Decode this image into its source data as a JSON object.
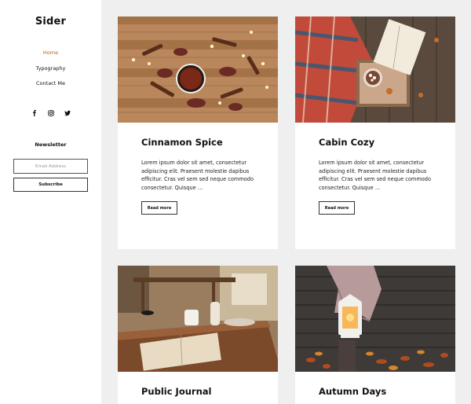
{
  "site": {
    "title": "Sider"
  },
  "nav": {
    "items": [
      "Home",
      "Typography",
      "Contact Me"
    ]
  },
  "social": {
    "icons": [
      "facebook-icon",
      "instagram-icon",
      "twitter-icon"
    ]
  },
  "newsletter": {
    "title": "Newsletter",
    "email_placeholder": "Email Address",
    "subscribe_label": "Subscribe"
  },
  "posts": [
    {
      "title": "Cinnamon Spice",
      "excerpt": "Lorem ipsum dolor sit amet, consectetur adipiscing elit. Praesent molestie dapibus efficitur. Cras vel sem sed neque commodo consectetur. Quisque …",
      "read_more": "Read more"
    },
    {
      "title": "Cabin Cozy",
      "excerpt": "Lorem ipsum dolor sit amet, consectetur adipiscing elit. Praesent molestie dapibus efficitur. Cras vel sem sed neque commodo consectetur. Quisque …",
      "read_more": "Read more"
    },
    {
      "title": "Public Journal"
    },
    {
      "title": "Autumn Days"
    }
  ],
  "colors": {
    "accent": "#b5651d",
    "background": "#efefef",
    "card": "#ffffff"
  }
}
